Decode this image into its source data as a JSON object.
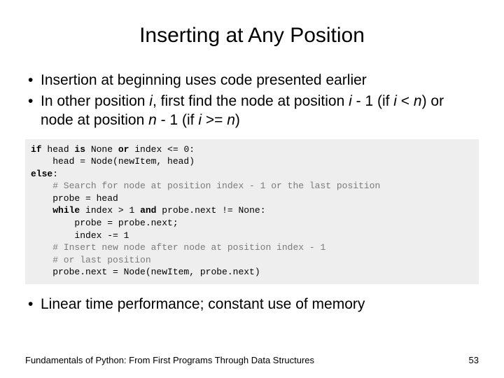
{
  "title": "Inserting at Any Position",
  "bullets": {
    "b1": "Insertion at beginning uses code presented earlier",
    "b2a": "In other position ",
    "b2b": ", first find the node at position ",
    "b2c": " - 1 (if ",
    "b2d": " < ",
    "b2e": ") or node at position ",
    "b2f": " - 1 (if ",
    "b2g": " >= ",
    "b2h": ")",
    "i": "i",
    "n": "n",
    "b3": "Linear time performance; constant use of memory"
  },
  "code": {
    "l1a": "if",
    "l1b": " head ",
    "l1c": "is",
    "l1d": " None ",
    "l1e": "or",
    "l1f": " index <= 0:",
    "l2": "    head = Node(newItem, head)",
    "l3a": "else",
    "l3b": ":",
    "l4": "    # Search for node at position index - 1 or the last position",
    "l5": "    probe = head",
    "l6a": "    ",
    "l6b": "while",
    "l6c": " index > 1 ",
    "l6d": "and",
    "l6e": " probe.next != None:",
    "l7": "        probe = probe.next;",
    "l8": "        index -= 1",
    "l9": "    # Insert new node after node at position index - 1",
    "l10": "    # or last position",
    "l11": "    probe.next = Node(newItem, probe.next)"
  },
  "footer": {
    "book": "Fundamentals of Python: From First Programs Through Data Structures",
    "page": "53"
  }
}
